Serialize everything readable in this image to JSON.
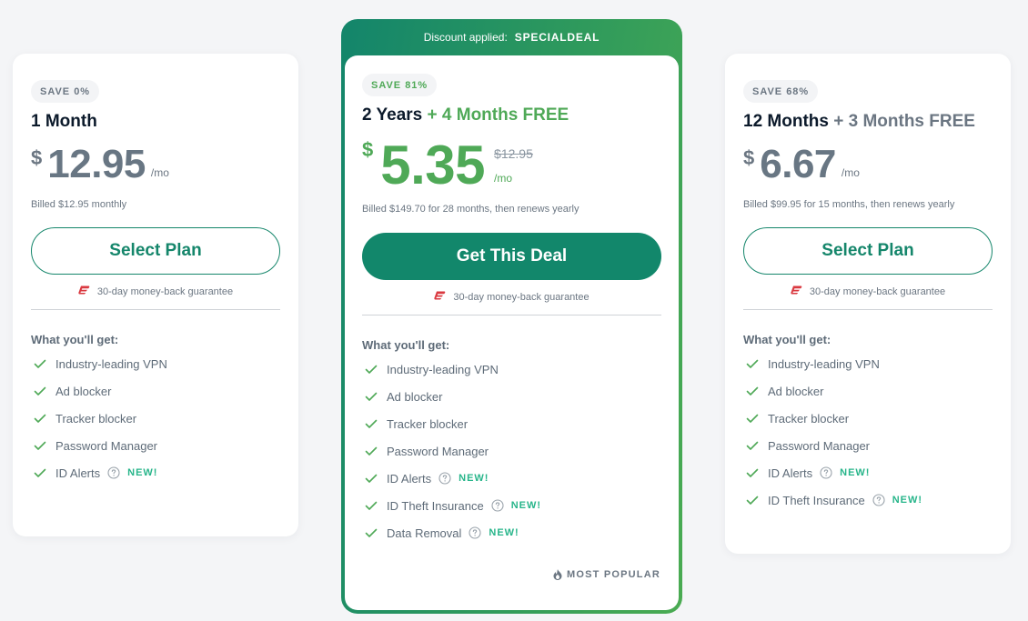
{
  "colors": {
    "brand_green": "#4fa957",
    "button_teal": "#12876b",
    "new_badge": "#27b58a",
    "guarantee_icon": "#da3940"
  },
  "plans": [
    {
      "id": "monthly",
      "save_badge": "SAVE 0%",
      "title": "1 Month",
      "bonus": "",
      "currency": "$",
      "price": "12.95",
      "per": "/mo",
      "billed": "Billed $12.95 monthly",
      "cta": "Select Plan",
      "guarantee": "30-day money-back guarantee",
      "features_title": "What you'll get:",
      "features": [
        {
          "label": "Industry-leading VPN"
        },
        {
          "label": "Ad blocker"
        },
        {
          "label": "Tracker blocker"
        },
        {
          "label": "Password Manager"
        },
        {
          "label": "ID Alerts",
          "help": true,
          "new": "NEW!"
        }
      ]
    },
    {
      "id": "two-year",
      "banner_label": "Discount applied:",
      "banner_code": "SPECIALDEAL",
      "save_badge": "SAVE 81%",
      "title": "2 Years",
      "bonus": "+ 4 Months FREE",
      "currency": "$",
      "price": "5.35",
      "old_price": "$12.95",
      "per": "/mo",
      "billed": "Billed $149.70 for 28 months, then renews yearly",
      "cta": "Get This Deal",
      "guarantee": "30-day money-back guarantee",
      "features_title": "What you'll get:",
      "features": [
        {
          "label": "Industry-leading VPN"
        },
        {
          "label": "Ad blocker"
        },
        {
          "label": "Tracker blocker"
        },
        {
          "label": "Password Manager"
        },
        {
          "label": "ID Alerts",
          "help": true,
          "new": "NEW!"
        },
        {
          "label": "ID Theft Insurance",
          "help": true,
          "new": "NEW!"
        },
        {
          "label": "Data Removal",
          "help": true,
          "new": "NEW!"
        }
      ],
      "popular_label": "MOST POPULAR"
    },
    {
      "id": "annual",
      "save_badge": "SAVE 68%",
      "title": "12 Months",
      "bonus": "+ 3 Months FREE",
      "currency": "$",
      "price": "6.67",
      "per": "/mo",
      "billed": "Billed $99.95 for 15 months, then renews yearly",
      "cta": "Select Plan",
      "guarantee": "30-day money-back guarantee",
      "features_title": "What you'll get:",
      "features": [
        {
          "label": "Industry-leading VPN"
        },
        {
          "label": "Ad blocker"
        },
        {
          "label": "Tracker blocker"
        },
        {
          "label": "Password Manager"
        },
        {
          "label": "ID Alerts",
          "help": true,
          "new": "NEW!"
        },
        {
          "label": "ID Theft Insurance",
          "help": true,
          "new": "NEW!"
        }
      ]
    }
  ]
}
